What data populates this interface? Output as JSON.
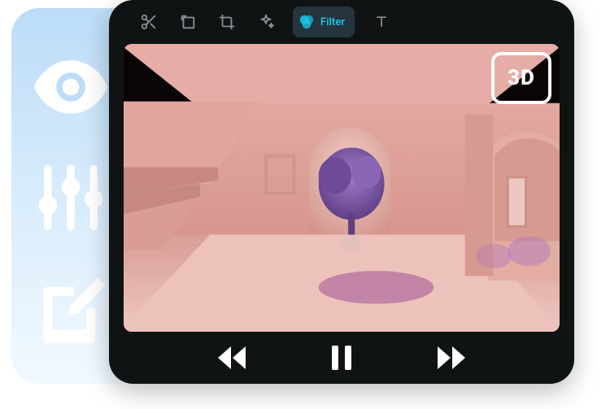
{
  "sidebar": {
    "tools": [
      {
        "name": "preview-tool",
        "icon": "eye-icon"
      },
      {
        "name": "adjust-tool",
        "icon": "sliders-icon"
      },
      {
        "name": "edit-tool",
        "icon": "compose-icon"
      }
    ]
  },
  "editor": {
    "toolbar": {
      "items": [
        {
          "name": "cut-tool",
          "icon": "scissors-icon",
          "active": false
        },
        {
          "name": "shape-tool",
          "icon": "square-rotate-icon",
          "active": false
        },
        {
          "name": "crop-tool",
          "icon": "crop-icon",
          "active": false
        },
        {
          "name": "effects-tool",
          "icon": "sparkle-icon",
          "active": false
        },
        {
          "name": "filter-tool",
          "icon": "filter-blobs-icon",
          "active": true,
          "label": "Filter"
        },
        {
          "name": "text-tool",
          "icon": "text-icon",
          "active": false
        }
      ]
    },
    "viewport": {
      "badge": "3D",
      "filter_applied": "pink-tint"
    },
    "controls": {
      "rewind": "rewind-icon",
      "play_state": "paused",
      "forward": "fast-forward-icon"
    }
  },
  "colors": {
    "accent": "#1bc3e3",
    "panel_gradient_top": "#bcdcf7",
    "panel_gradient_bottom": "#f2f9ff",
    "scene_tint": "#e9a9a4",
    "tree": "#7f5ab0"
  }
}
